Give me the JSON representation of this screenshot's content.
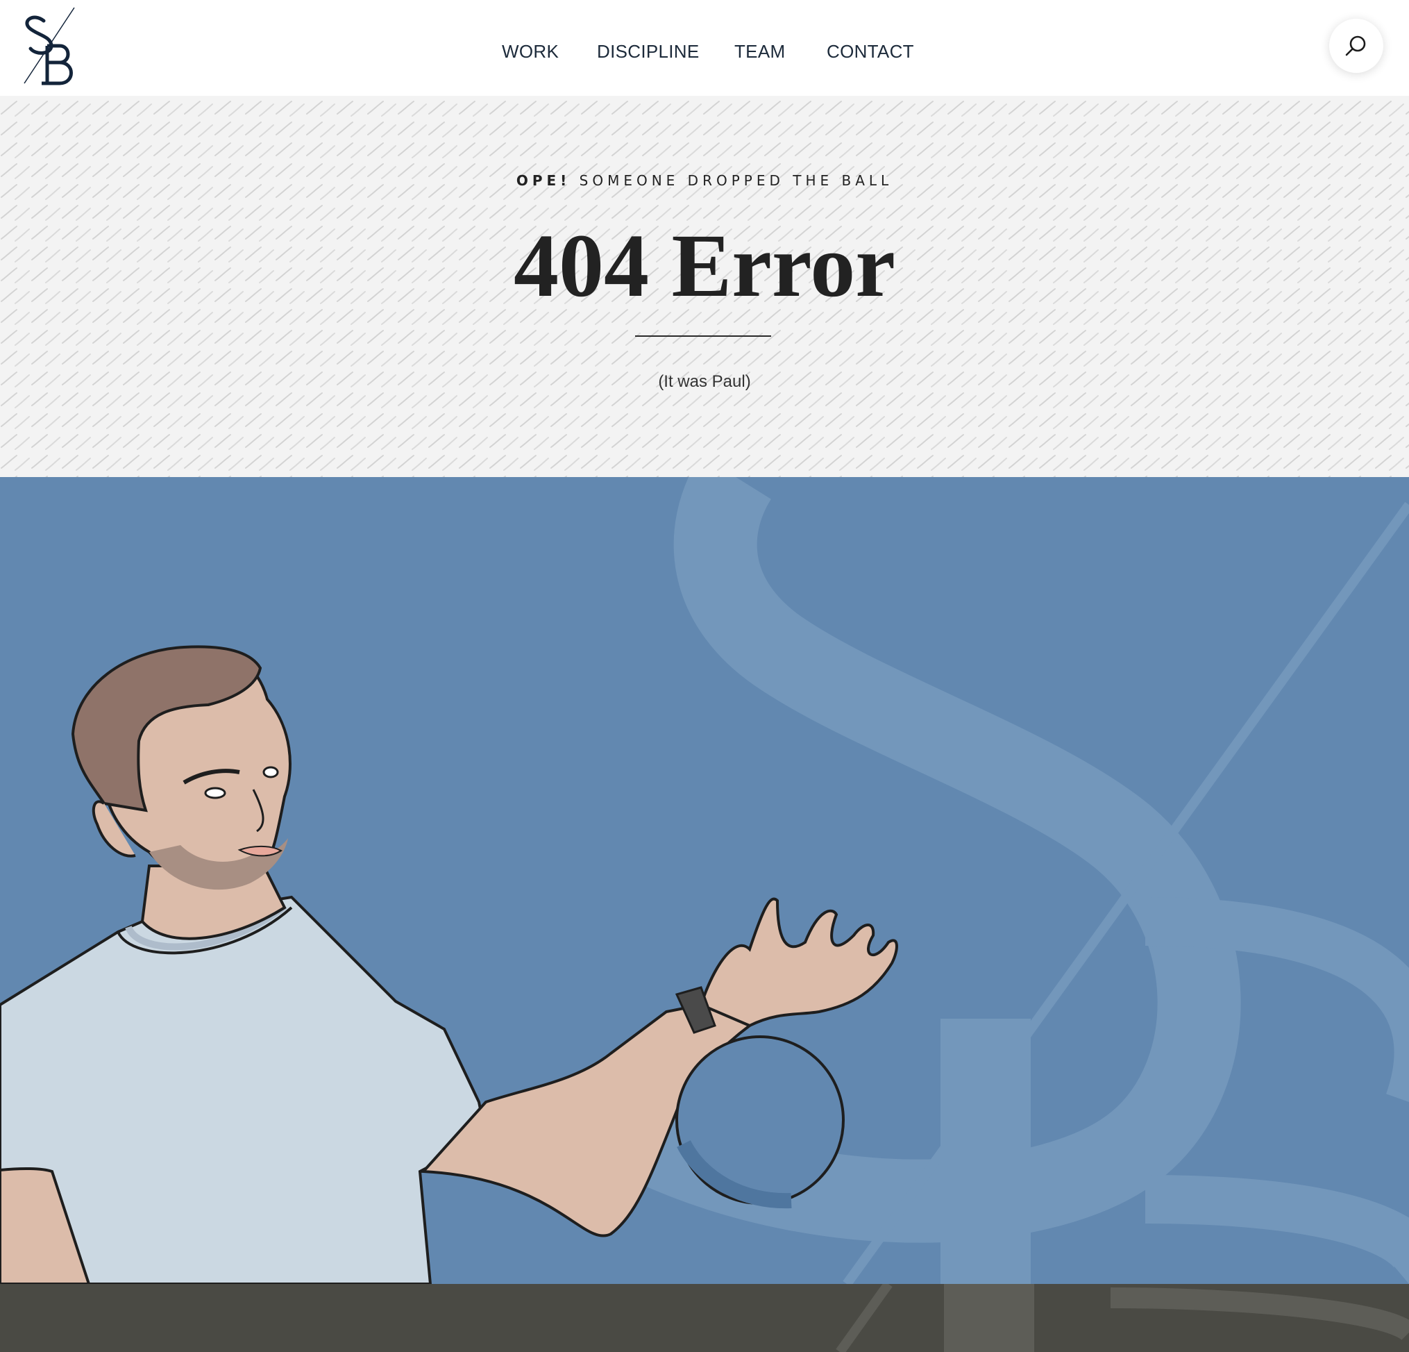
{
  "header": {
    "logo_text": "SB",
    "nav": [
      {
        "label": "WORK"
      },
      {
        "label": "DISCIPLINE"
      },
      {
        "label": "TEAM"
      },
      {
        "label": "CONTACT"
      }
    ],
    "search_icon": "search-icon"
  },
  "hero": {
    "eyebrow_bold": "OPE!",
    "eyebrow_rest": " SOMEONE DROPPED THE BALL",
    "title": "404 Error",
    "subtitle": "(It was Paul)"
  },
  "colors": {
    "illustration_bg": "#6288b0",
    "monogram_overlay": "#7397bb",
    "footer_bg": "#4a4a44",
    "hero_bg": "#f3f3f3",
    "shirt": "#cbd8e2",
    "skin": "#dcbcaa"
  }
}
